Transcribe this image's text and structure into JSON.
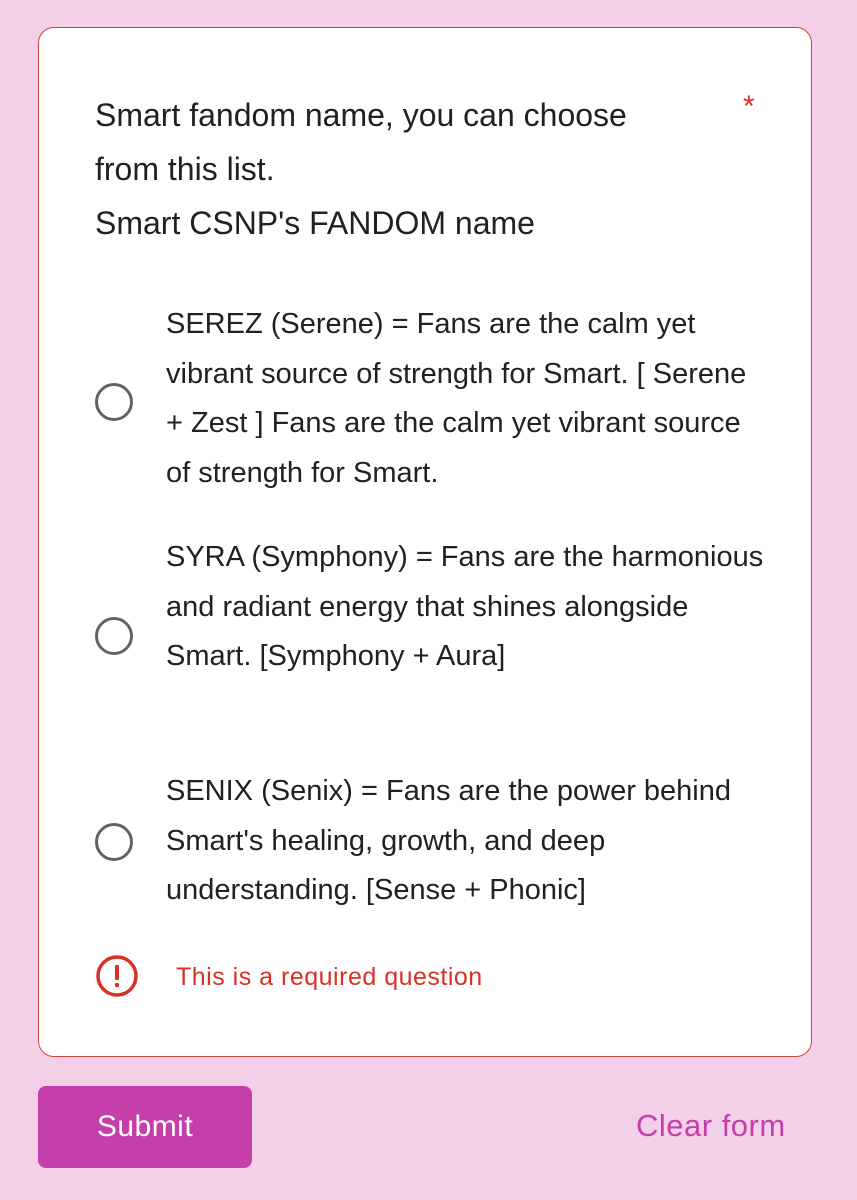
{
  "question": {
    "title_lines": [
      "Smart fandom name, you can choose",
      "from this list.",
      "Smart CSNP's FANDOM name"
    ],
    "required_marker": "*",
    "options": [
      {
        "label": "SEREZ (Serene) = Fans are the calm yet vibrant source of strength for Smart. [ Serene + Zest ] Fans are the calm yet vibrant source of strength for Smart.",
        "selected": false
      },
      {
        "label": "SYRA (Symphony) = Fans are the harmonious and radiant energy that shines alongside Smart. [Symphony + Aura]",
        "selected": false
      },
      {
        "label": "SENIX (Senix) = Fans are the power behind Smart's healing, growth, and deep understanding. [Sense + Phonic]",
        "selected": false
      }
    ],
    "error_icon": "error-exclamation-icon",
    "error_message": "This is a required question"
  },
  "actions": {
    "submit_label": "Submit",
    "clear_label": "Clear form"
  },
  "colors": {
    "background": "#f3cfe8",
    "accent": "#c53faa",
    "error": "#d93025"
  }
}
